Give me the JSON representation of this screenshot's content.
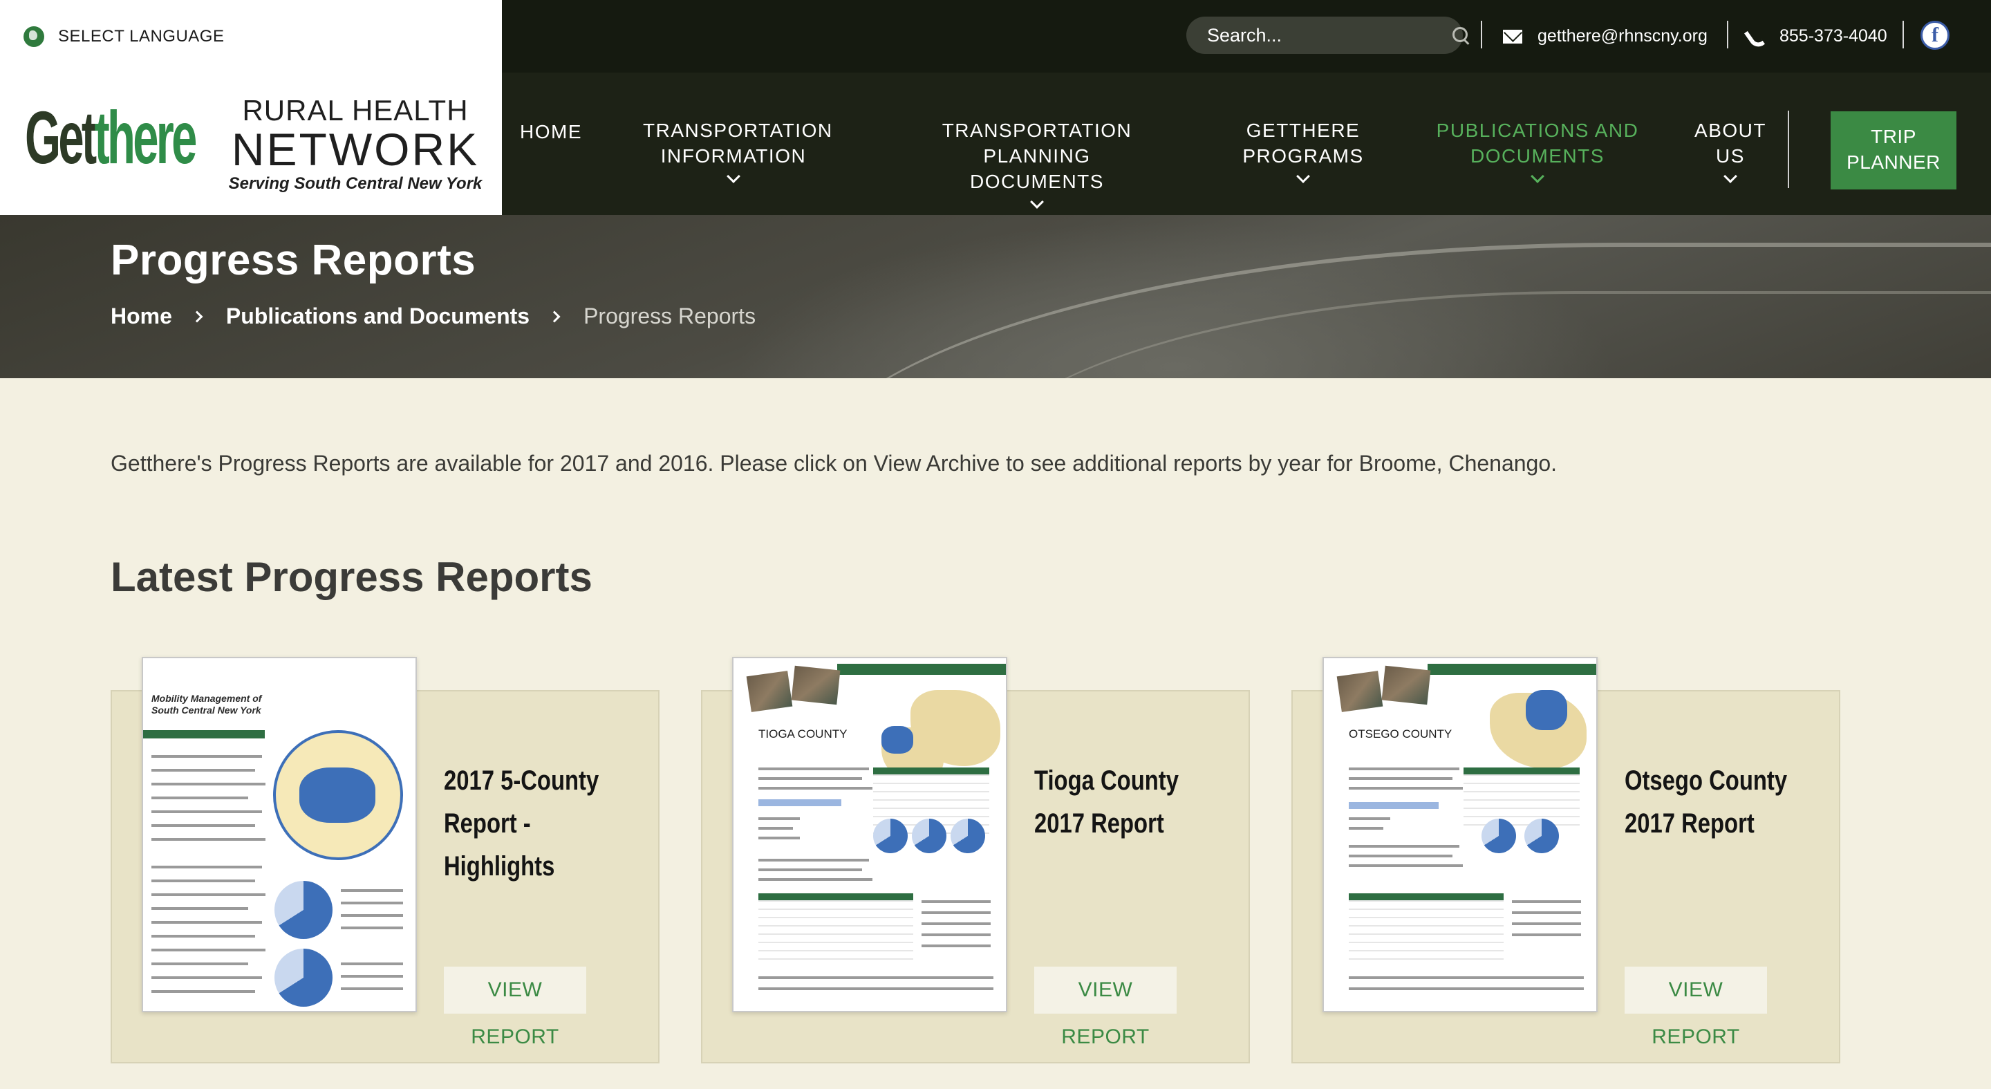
{
  "header": {
    "select_language": "SELECT LANGUAGE",
    "search_placeholder": "Search...",
    "email": "getthere@rhnscny.org",
    "phone": "855-373-4040",
    "logo": {
      "getthere_get": "Get",
      "getthere_there": "there",
      "line1": "RURAL HEALTH",
      "line2": "NETWORK",
      "line3": "Serving South Central New York"
    },
    "facebook_glyph": "f"
  },
  "nav": {
    "items": [
      {
        "line1": "HOME",
        "line2": ""
      },
      {
        "line1": "TRANSPORTATION",
        "line2": "INFORMATION"
      },
      {
        "line1": "TRANSPORTATION PLANNING",
        "line2": "DOCUMENTS"
      },
      {
        "line1": "GETTHERE",
        "line2": "PROGRAMS"
      },
      {
        "line1": "PUBLICATIONS AND",
        "line2": "DOCUMENTS"
      },
      {
        "line1": "ABOUT",
        "line2": "US"
      }
    ],
    "trip_planner": {
      "line1": "TRIP",
      "line2": "PLANNER"
    },
    "active_color": "#57b15c"
  },
  "hero": {
    "title": "Progress Reports",
    "breadcrumb": [
      "Home",
      "Publications and Documents",
      "Progress Reports"
    ]
  },
  "content": {
    "intro": "Getthere's Progress Reports are available for 2017 and 2016. Please click on View Archive to see additional reports by year for Broome, Chenango.",
    "section_title": "Latest Progress Reports",
    "cards": [
      {
        "title_lines": [
          "2017 5-County",
          "Report -",
          "Highlights"
        ],
        "button": "VIEW REPORT",
        "doc_heading": "Mobility Management of South Central New York"
      },
      {
        "title_lines": [
          "Tioga County",
          "2017 Report"
        ],
        "button": "VIEW REPORT",
        "doc_heading": "TIOGA COUNTY"
      },
      {
        "title_lines": [
          "Otsego County",
          "2017 Report"
        ],
        "button": "VIEW REPORT",
        "doc_heading": "OTSEGO COUNTY"
      }
    ]
  },
  "colors": {
    "accent_green": "#3b8a44",
    "page_bg": "#f3f0e1",
    "card_bg": "#e8e3c7",
    "header_dark": "#151a10"
  }
}
